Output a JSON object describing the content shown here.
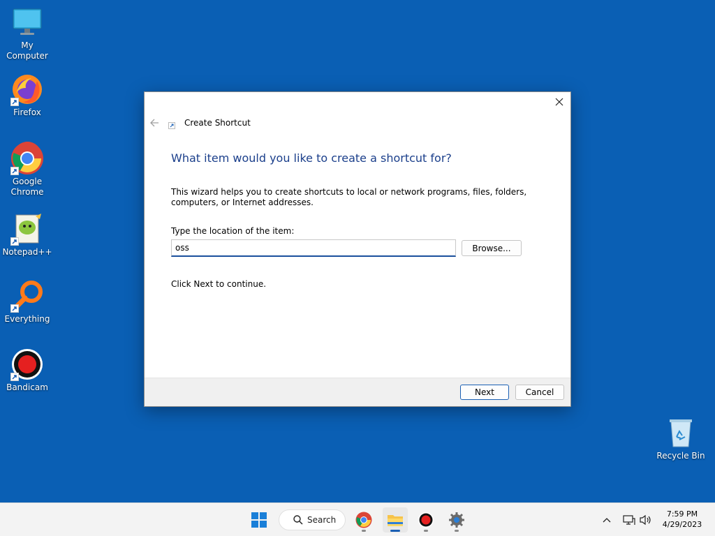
{
  "desktop": {
    "icons": [
      {
        "label": "My Computer",
        "icon": "monitor-icon"
      },
      {
        "label": "Firefox",
        "icon": "firefox-icon"
      },
      {
        "label": "Google Chrome",
        "icon": "chrome-icon"
      },
      {
        "label": "Notepad++",
        "icon": "notepadpp-icon"
      },
      {
        "label": "Everything",
        "icon": "everything-icon"
      },
      {
        "label": "Bandicam",
        "icon": "bandicam-icon"
      },
      {
        "label": "Recycle Bin",
        "icon": "recycle-bin-icon"
      }
    ]
  },
  "dialog": {
    "wizard_title": "Create Shortcut",
    "heading": "What item would you like to create a shortcut for?",
    "description": "This wizard helps you to create shortcuts to local or network programs, files, folders, computers, or Internet addresses.",
    "location_label": "Type the location of the item:",
    "location_value": "oss",
    "browse_label": "Browse...",
    "continue_text": "Click Next to continue.",
    "next_label": "Next",
    "cancel_label": "Cancel"
  },
  "taskbar": {
    "search_label": "Search",
    "time": "7:59 PM",
    "date": "4/29/2023"
  },
  "colors": {
    "desktop_bg": "#0a5fb4",
    "heading": "#1b3f8b",
    "accent": "#1a5fb4"
  }
}
